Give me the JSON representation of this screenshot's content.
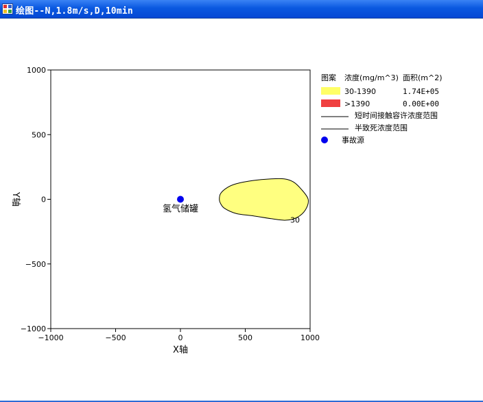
{
  "window": {
    "title": "绘图--N,1.8m/s,D,10min",
    "colors": {
      "titlebar": "#0a58e0",
      "title_text": "#ffffff"
    }
  },
  "chart_data": {
    "type": "area",
    "xlabel": "X轴",
    "ylabel": "Y轴",
    "xlim": [
      -1000,
      1000
    ],
    "ylim": [
      -1000,
      1000
    ],
    "xticks": [
      -1000,
      -500,
      0,
      500,
      1000
    ],
    "yticks": [
      1000,
      500,
      0,
      -500,
      -1000
    ],
    "xtick_labels": [
      "−1000",
      "−500",
      "0",
      "500",
      "1000"
    ],
    "ytick_labels": [
      "1000",
      "500",
      "0",
      "−500",
      "−1000"
    ],
    "grid": false,
    "legend_position": "right",
    "legend": {
      "header": {
        "pattern": "图案",
        "concentration": "浓度(mg/m^3)",
        "area": "面积(m^2)"
      },
      "entries": [
        {
          "range": "30-1390",
          "area": "1.74E+05",
          "color": "#ffff66"
        },
        {
          "range": ">1390",
          "area": "0.00E+00",
          "color": "#f04040"
        }
      ],
      "line_entries": [
        "短时间接触容许浓度范围",
        "半致死浓度范围"
      ],
      "marker_entry": "事故源"
    },
    "source": {
      "x": 0,
      "y": 0,
      "label": "氢气储罐",
      "color": "#0000ee"
    },
    "contour": {
      "level_label": "30",
      "label_at": [
        820,
        -160
      ],
      "fill": "#ffff80",
      "points": [
        [
          300,
          0
        ],
        [
          310,
          45
        ],
        [
          360,
          90
        ],
        [
          430,
          120
        ],
        [
          560,
          145
        ],
        [
          700,
          158
        ],
        [
          800,
          158
        ],
        [
          870,
          135
        ],
        [
          930,
          80
        ],
        [
          985,
          0
        ],
        [
          965,
          -80
        ],
        [
          900,
          -140
        ],
        [
          810,
          -162
        ],
        [
          700,
          -150
        ],
        [
          560,
          -128
        ],
        [
          430,
          -110
        ],
        [
          340,
          -70
        ],
        [
          308,
          -30
        ]
      ]
    }
  }
}
